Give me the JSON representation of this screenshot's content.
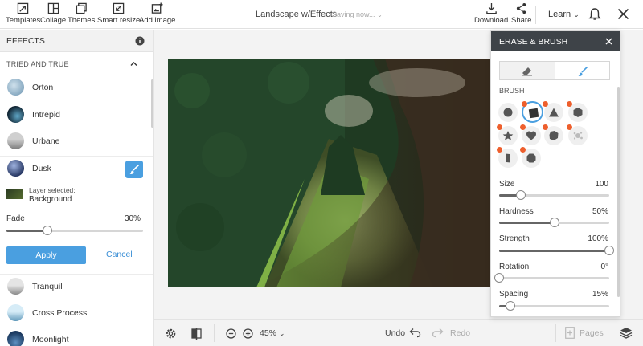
{
  "toolbar": {
    "tools": [
      {
        "label": "Templates",
        "icon": "templates-icon"
      },
      {
        "label": "Collage",
        "icon": "collage-icon"
      },
      {
        "label": "Themes",
        "icon": "themes-icon"
      },
      {
        "label": "Smart resize",
        "icon": "smart-resize-icon"
      },
      {
        "label": "Add image",
        "icon": "add-image-icon"
      }
    ],
    "document_title": "Landscape w/Effects",
    "saving_status": "Saving now...",
    "download_label": "Download",
    "share_label": "Share",
    "learn_label": "Learn"
  },
  "effects_panel": {
    "title": "EFFECTS",
    "section": "TRIED AND TRUE",
    "items_top": [
      {
        "name": "Orton",
        "color": "#8fb2c9"
      },
      {
        "name": "Intrepid",
        "color": "#1f3a4a"
      },
      {
        "name": "Urbane",
        "color": "#9a9a9a"
      },
      {
        "name": "Dusk",
        "color": "#3a4d7a"
      }
    ],
    "layer_selected_label": "Layer selected:",
    "layer_selected_value": "Background",
    "fade_label": "Fade",
    "fade_value": "30%",
    "fade_level": 0.3,
    "apply_label": "Apply",
    "cancel_label": "Cancel",
    "items_bottom": [
      {
        "name": "Tranquil",
        "color": "#a8a8a8"
      },
      {
        "name": "Cross Process",
        "color": "#6fa5c4"
      },
      {
        "name": "Moonlight",
        "color": "#2c4f78"
      }
    ]
  },
  "erase_brush": {
    "title": "ERASE & BRUSH",
    "brush_label": "BRUSH",
    "sliders": [
      {
        "label": "Size",
        "value": "100",
        "level": 0.2
      },
      {
        "label": "Hardness",
        "value": "50%",
        "level": 0.5
      },
      {
        "label": "Strength",
        "value": "100%",
        "level": 1.0
      },
      {
        "label": "Rotation",
        "value": "0°",
        "level": 0.0
      },
      {
        "label": "Spacing",
        "value": "15%",
        "level": 0.1
      }
    ]
  },
  "bottom_bar": {
    "zoom": "45%",
    "undo_label": "Undo",
    "redo_label": "Redo",
    "pages_label": "Pages"
  },
  "colors": {
    "accent": "#4a9fe0",
    "premium_dot": "#ee5f2d",
    "panel_header": "#3e4348"
  }
}
